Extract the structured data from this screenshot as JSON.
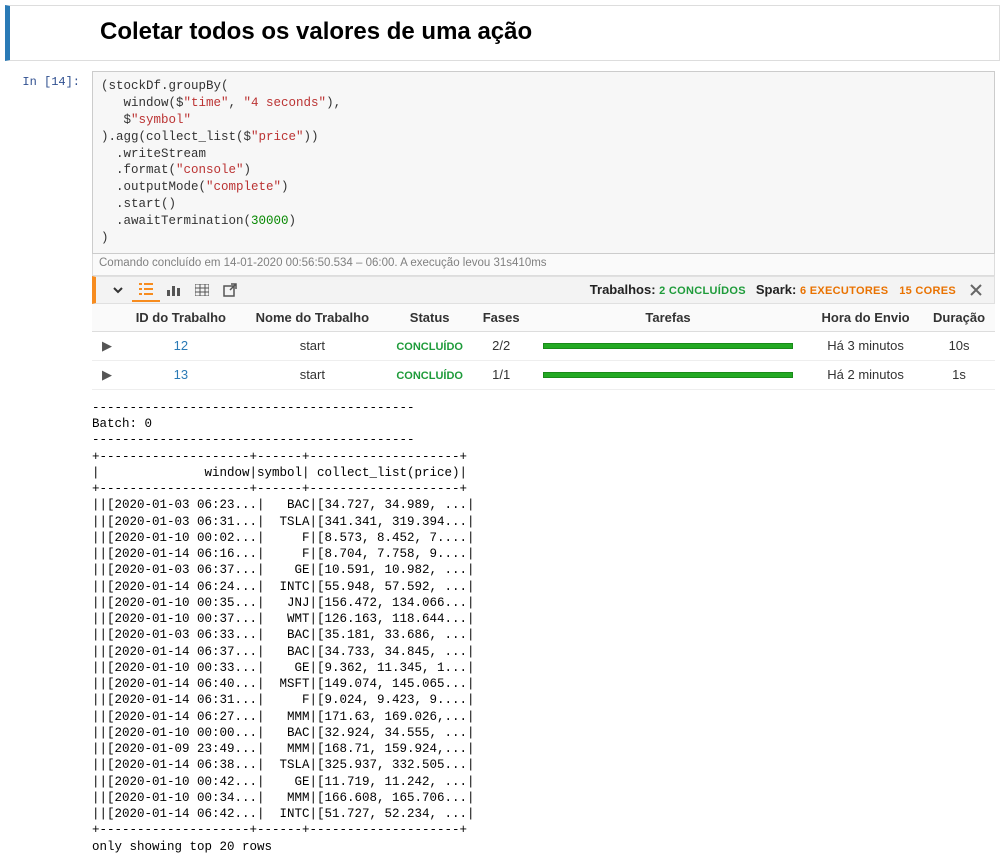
{
  "heading": "Coletar todos os valores de uma ação",
  "prompt": "In [14]:",
  "code_plain": "(stockDf.groupBy(\n   window($\"time\", \"4 seconds\"),\n   $\"symbol\"\n).agg(collect_list($\"price\"))\n  .writeStream\n  .format(\"console\")\n  .outputMode(\"complete\")\n  .start()\n  .awaitTermination(30000)\n)",
  "status_line": "Comando concluído em 14-01-2020 00:56:50.534 – 06:00. A execução levou 31s410ms",
  "widget": {
    "jobs_label": "Trabalhos:",
    "jobs_value": "2 CONCLUÍDOS",
    "spark_label": "Spark:",
    "executors": "6 EXECUTORES",
    "cores": "15 CORES"
  },
  "jobs_header": {
    "id": "ID do Trabalho",
    "name": "Nome do Trabalho",
    "status": "Status",
    "stages": "Fases",
    "tasks": "Tarefas",
    "submit": "Hora do Envio",
    "duration": "Duração"
  },
  "jobs": [
    {
      "id": "12",
      "name": "start",
      "status": "CONCLUÍDO",
      "stages": "2/2",
      "submit": "Há 3 minutos",
      "duration": "10s"
    },
    {
      "id": "13",
      "name": "start",
      "status": "CONCLUÍDO",
      "stages": "1/1",
      "submit": "Há 2 minutos",
      "duration": "1s"
    }
  ],
  "output_text": "-------------------------------------------\nBatch: 0\n-------------------------------------------\n+--------------------+------+--------------------+\n|              window|symbol| collect_list(price)|\n+--------------------+------+--------------------+\n||[2020-01-03 06:23...|   BAC|[34.727, 34.989, ...|\n||[2020-01-03 06:31...|  TSLA|[341.341, 319.394...|\n||[2020-01-10 00:02...|     F|[8.573, 8.452, 7....|\n||[2020-01-14 06:16...|     F|[8.704, 7.758, 9....|\n||[2020-01-03 06:37...|    GE|[10.591, 10.982, ...|\n||[2020-01-14 06:24...|  INTC|[55.948, 57.592, ...|\n||[2020-01-10 00:35...|   JNJ|[156.472, 134.066...|\n||[2020-01-10 00:37...|   WMT|[126.163, 118.644...|\n||[2020-01-03 06:33...|   BAC|[35.181, 33.686, ...|\n||[2020-01-14 06:37...|   BAC|[34.733, 34.845, ...|\n||[2020-01-10 00:33...|    GE|[9.362, 11.345, 1...|\n||[2020-01-14 06:40...|  MSFT|[149.074, 145.065...|\n||[2020-01-14 06:31...|     F|[9.024, 9.423, 9....|\n||[2020-01-14 06:27...|   MMM|[171.63, 169.026,...|\n||[2020-01-10 00:00...|   BAC|[32.924, 34.555, ...|\n||[2020-01-09 23:49...|   MMM|[168.71, 159.924,...|\n||[2020-01-14 06:38...|  TSLA|[325.937, 332.505...|\n||[2020-01-10 00:42...|    GE|[11.719, 11.242, ...|\n||[2020-01-10 00:34...|   MMM|[166.608, 165.706...|\n||[2020-01-14 06:42...|  INTC|[51.727, 52.234, ...|\n+--------------------+------+--------------------+\nonly showing top 20 rows"
}
